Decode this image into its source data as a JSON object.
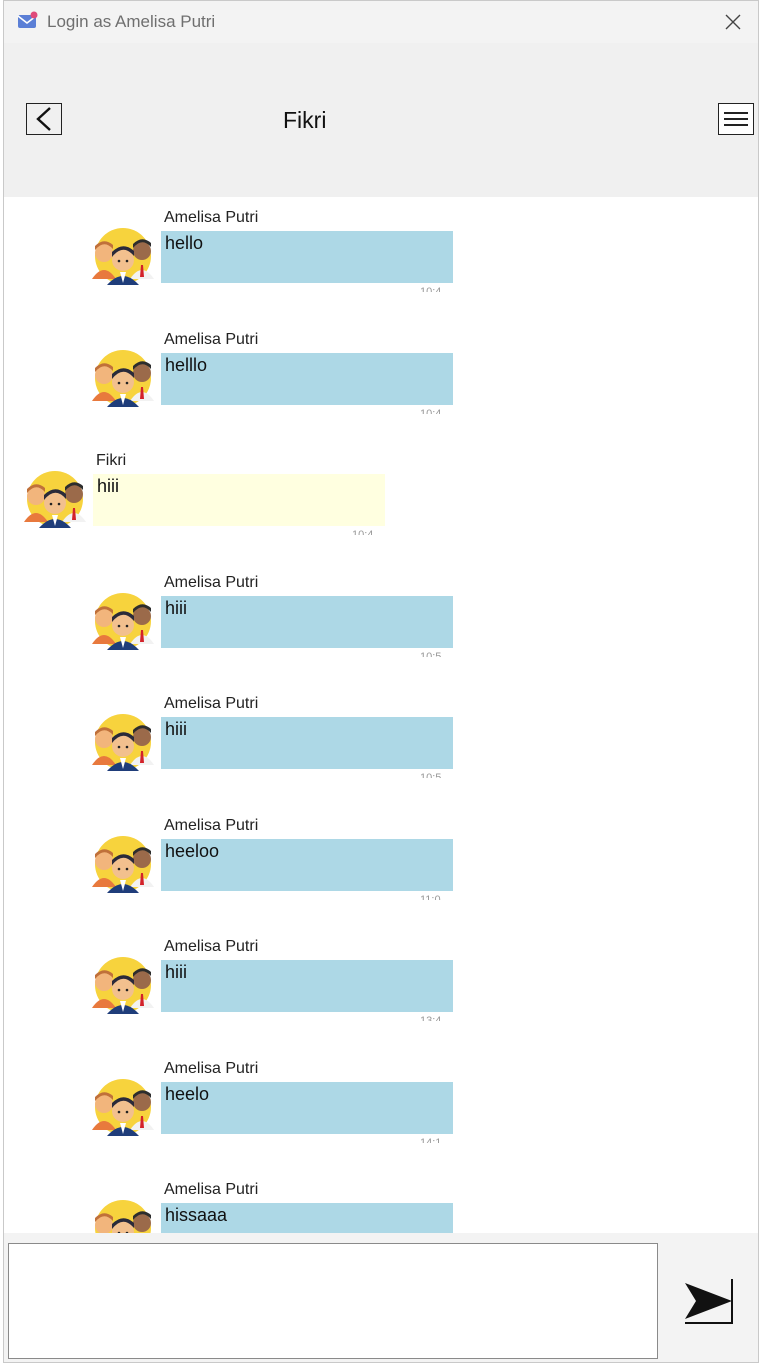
{
  "window": {
    "title": "Login as Amelisa Putri"
  },
  "header": {
    "contact_name": "Fikri"
  },
  "messages": [
    {
      "sender": "Amelisa Putri",
      "text": "hello",
      "time": "10:4",
      "type": "sent"
    },
    {
      "sender": "Amelisa Putri",
      "text": "helllo",
      "time": "10:4",
      "type": "sent"
    },
    {
      "sender": "Fikri",
      "text": "hiii",
      "time": "10:4",
      "type": "received"
    },
    {
      "sender": "Amelisa Putri",
      "text": "hiii",
      "time": "10:5",
      "type": "sent"
    },
    {
      "sender": "Amelisa Putri",
      "text": "hiii",
      "time": "10:5",
      "type": "sent"
    },
    {
      "sender": "Amelisa Putri",
      "text": "heeloo",
      "time": "11:0",
      "type": "sent"
    },
    {
      "sender": "Amelisa Putri",
      "text": "hiii",
      "time": "13:4",
      "type": "sent"
    },
    {
      "sender": "Amelisa Putri",
      "text": "heelo",
      "time": "14:1",
      "type": "sent"
    },
    {
      "sender": "Amelisa Putri",
      "text": "hissaaa",
      "time": "",
      "type": "sent"
    }
  ],
  "composer": {
    "value": "",
    "placeholder": ""
  },
  "colors": {
    "sent_bubble": "#add8e6",
    "received_bubble": "#ffffe0",
    "header_bg": "#f0f0f0"
  },
  "icons": {
    "app": "mail-icon",
    "close": "close-icon",
    "back": "back-arrow-icon",
    "menu": "menu-icon",
    "send": "send-icon",
    "avatar": "group-avatar-icon"
  }
}
